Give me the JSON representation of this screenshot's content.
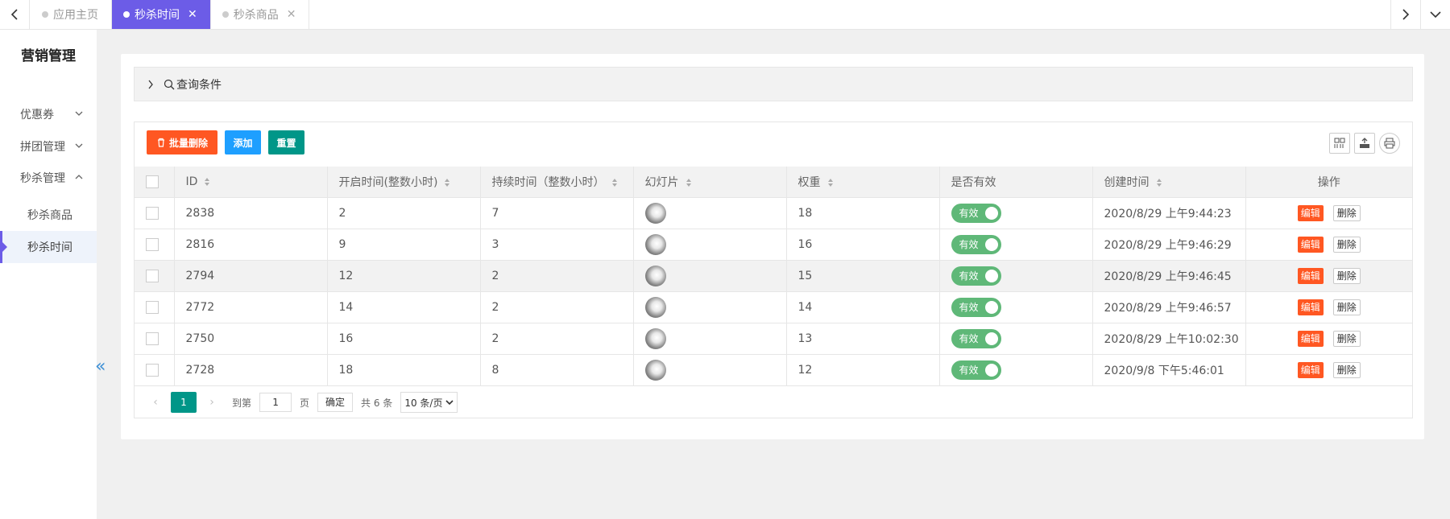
{
  "tabs": [
    {
      "label": "应用主页",
      "active": false
    },
    {
      "label": "秒杀时间",
      "active": true
    },
    {
      "label": "秒杀商品",
      "active": false
    }
  ],
  "sidebar": {
    "title": "营销管理",
    "items": [
      {
        "label": "优惠券"
      },
      {
        "label": "拼团管理"
      },
      {
        "label": "秒杀管理"
      }
    ],
    "sub_items": [
      {
        "label": "秒杀商品"
      },
      {
        "label": "秒杀时间"
      }
    ]
  },
  "query": {
    "label": "查询条件"
  },
  "toolbar": {
    "batch_delete": "批量删除",
    "add": "添加",
    "reset": "重置"
  },
  "table": {
    "headers": [
      "ID",
      "开启时间(整数小时)",
      "持续时间（整数小时）",
      "幻灯片",
      "权重",
      "是否有效",
      "创建时间",
      "操作"
    ],
    "rows": [
      {
        "id": "2838",
        "start": "2",
        "duration": "7",
        "weight": "18",
        "status": "有效",
        "created": "2020/8/29 上午9:44:23"
      },
      {
        "id": "2816",
        "start": "9",
        "duration": "3",
        "weight": "16",
        "status": "有效",
        "created": "2020/8/29 上午9:46:29"
      },
      {
        "id": "2794",
        "start": "12",
        "duration": "2",
        "weight": "15",
        "status": "有效",
        "created": "2020/8/29 上午9:46:45"
      },
      {
        "id": "2772",
        "start": "14",
        "duration": "2",
        "weight": "14",
        "status": "有效",
        "created": "2020/8/29 上午9:46:57"
      },
      {
        "id": "2750",
        "start": "16",
        "duration": "2",
        "weight": "13",
        "status": "有效",
        "created": "2020/8/29 上午10:02:30"
      },
      {
        "id": "2728",
        "start": "18",
        "duration": "8",
        "weight": "12",
        "status": "有效",
        "created": "2020/9/8 下午5:46:01"
      }
    ],
    "edit_label": "编辑",
    "delete_label": "删除"
  },
  "pager": {
    "current": "1",
    "goto_label": "到第",
    "page_input": "1",
    "page_unit": "页",
    "confirm": "确定",
    "total": "共 6 条",
    "page_size": "10 条/页"
  },
  "colors": {
    "accent": "#6c5ce7",
    "danger": "#ff5722",
    "primary": "#1e9fff",
    "teal": "#009688",
    "switch_on": "#5fb878"
  }
}
